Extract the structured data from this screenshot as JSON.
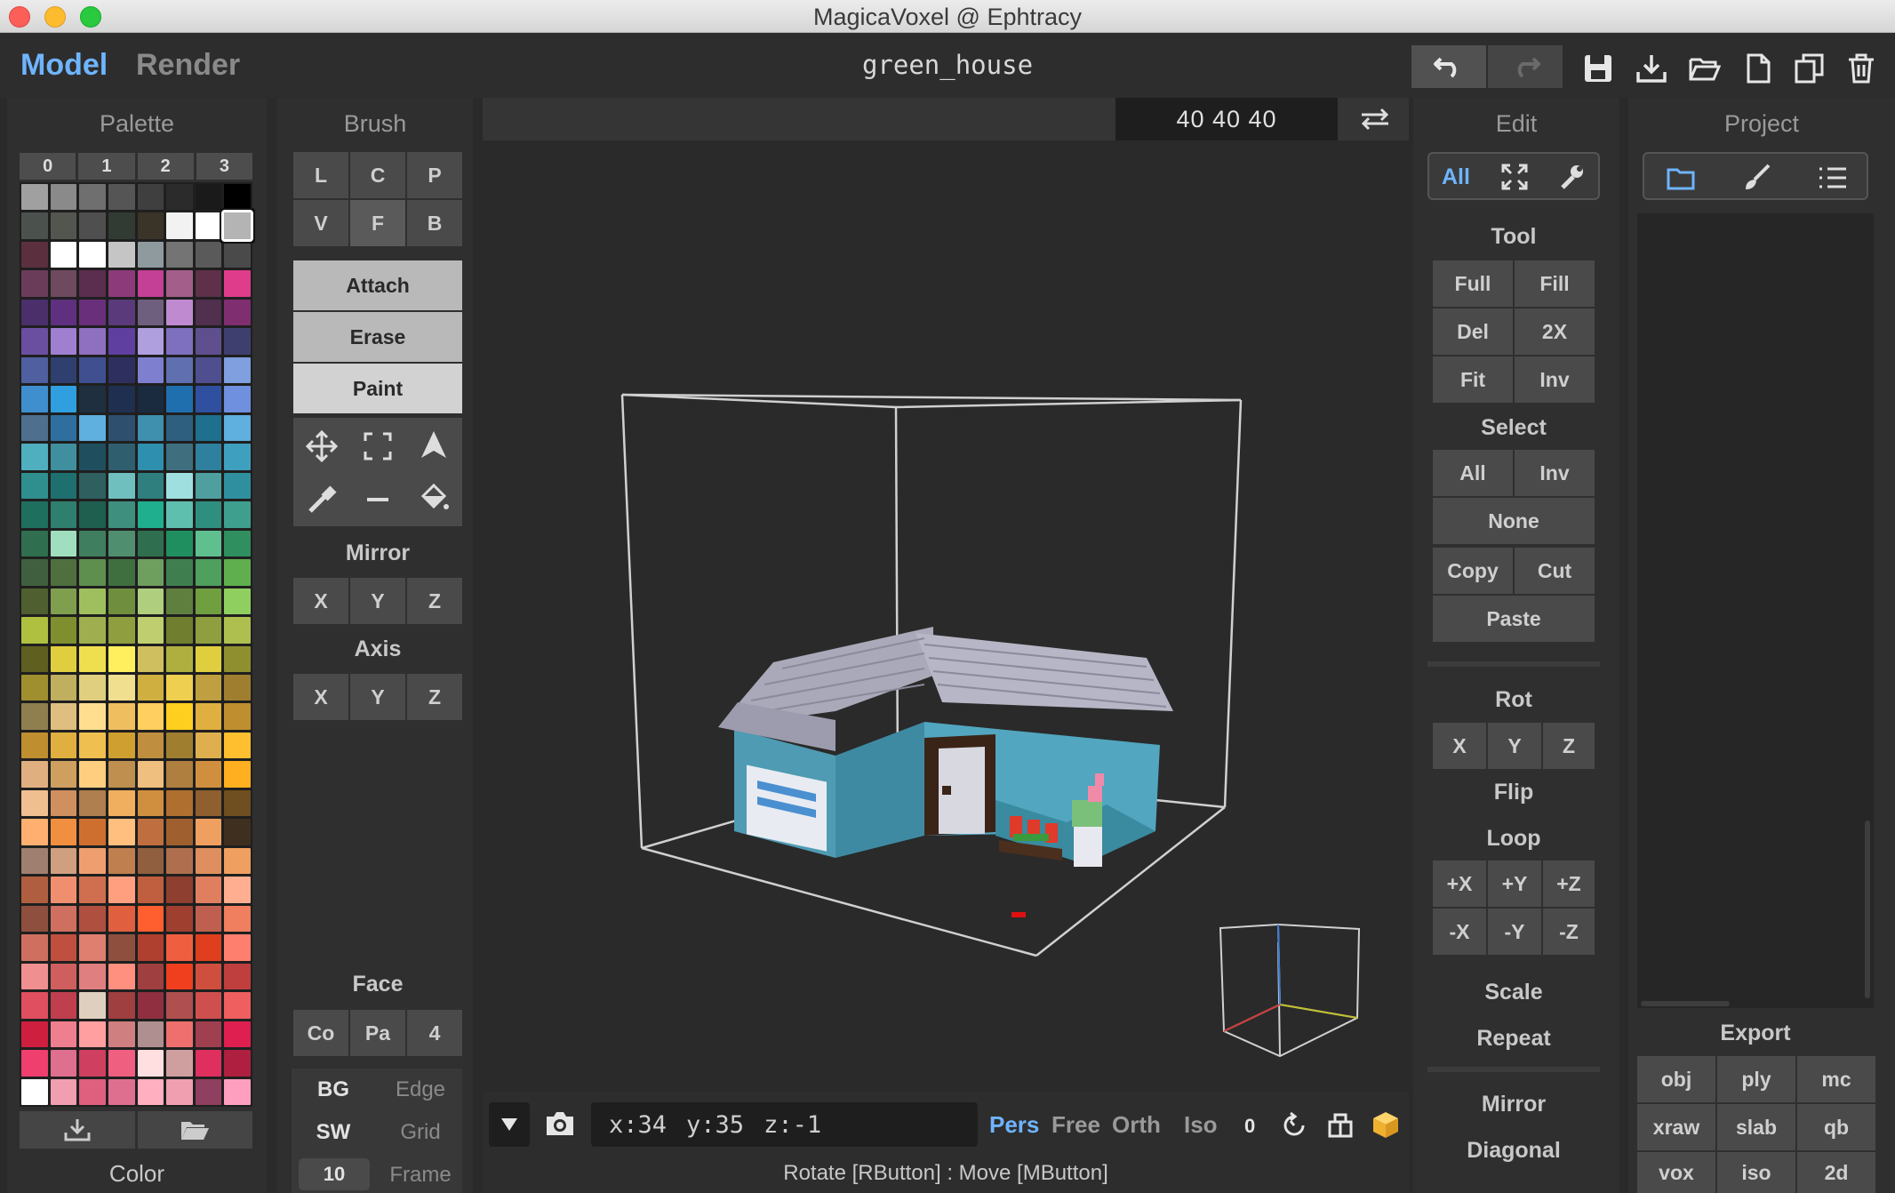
{
  "window": {
    "title": "MagicaVoxel @ Ephtracy"
  },
  "topbar": {
    "mode_model": "Model",
    "mode_render": "Render",
    "filename": "green_house"
  },
  "palette": {
    "title": "Palette",
    "tabs": [
      "0",
      "1",
      "2",
      "3"
    ],
    "footer": "Color",
    "colors": [
      "#a0a0a0",
      "#8a8a8a",
      "#6f6f6f",
      "#555555",
      "#3f3f3f",
      "#2b2b2b",
      "#1a1a1a",
      "#000000",
      "#4b524d",
      "#52564f",
      "#4f4f4f",
      "#313a33",
      "#3a3328",
      "#f2f2f2",
      "#ffffff",
      "#b4b4b4",
      "#5c2f3f",
      "#ffffff",
      "#ffffff",
      "#c5c5c5",
      "#8f9a9f",
      "#747474",
      "#5a5a5a",
      "#4a4a4a",
      "#6a3c5a",
      "#6f4a5f",
      "#5b2d4f",
      "#8d3a7a",
      "#c43f96",
      "#a35f89",
      "#5e304a",
      "#e03c8c",
      "#4a2f6a",
      "#5f3080",
      "#6a2f7a",
      "#5a3a7a",
      "#6f5f7f",
      "#bf8ad0",
      "#502f4f",
      "#7f2f6f",
      "#6a4fa0",
      "#9f7fd0",
      "#8f6fbf",
      "#5f3fa0",
      "#b09fdf",
      "#7f6fbf",
      "#5f4f8f",
      "#3f3f6f",
      "#4f5f9f",
      "#2f3f6f",
      "#3f4f8f",
      "#2f2f5f",
      "#7f7fcf",
      "#5f6faf",
      "#4f4f8f",
      "#7f9fdf",
      "#3f8fcf",
      "#2f9fdf",
      "#1f2f3f",
      "#1f2f4f",
      "#1a2a3f",
      "#1f6faf",
      "#2f4f9f",
      "#6f8fdf",
      "#4f6f8f",
      "#2f6f9f",
      "#5fafdf",
      "#2f4f6f",
      "#3f8faf",
      "#2f5f7f",
      "#1f6f8f",
      "#5fafdf",
      "#4fafbf",
      "#3f8f9f",
      "#1f4f5f",
      "#2f5f6f",
      "#2f8faf",
      "#3f6f7f",
      "#2f7f9f",
      "#3f9fbf",
      "#2f8f8f",
      "#1f6f6f",
      "#2f5f5f",
      "#6fbfbf",
      "#2f7f7f",
      "#9fdfdf",
      "#4f9f9f",
      "#2f8f9f",
      "#1f6f5f",
      "#2f7f6f",
      "#1f5f4f",
      "#3f8f7f",
      "#1faf8f",
      "#5fbfaf",
      "#2f8f7f",
      "#3f9f8f",
      "#2f6f4f",
      "#9fdfbf",
      "#3f7f5f",
      "#4f8f6f",
      "#2f6f4f",
      "#1f8f5f",
      "#5fbf8f",
      "#2f8f5f",
      "#3f5f3f",
      "#4f6f3f",
      "#5f8f4f",
      "#3f6f3f",
      "#6f9f5f",
      "#3f7f4f",
      "#4f9f5f",
      "#5faf4f",
      "#4f5f2f",
      "#7f9f4f",
      "#9fbf5f",
      "#6f8f3f",
      "#afcf7f",
      "#5f7f3f",
      "#6f9f3f",
      "#8fcf5f",
      "#afbf3f",
      "#7f8f2f",
      "#9faf4f",
      "#8f9f3f",
      "#bfcf6f",
      "#6f7f2f",
      "#8f9f3f",
      "#afbf4f",
      "#5f5f1f",
      "#dfcf3f",
      "#efdf4f",
      "#ffef5f",
      "#cfbf5f",
      "#afaf3f",
      "#dfcf3f",
      "#8f8f2f",
      "#9f8f2f",
      "#bfaf5f",
      "#dfcf7f",
      "#efdf8f",
      "#cfaf3f",
      "#efcf4f",
      "#bf9f3f",
      "#9f7f2f",
      "#8f7f4f",
      "#dfbf7f",
      "#ffdf8f",
      "#efbf5f",
      "#ffcf5f",
      "#ffcf1f",
      "#dfaf3f",
      "#bf8f2f",
      "#bf8f2f",
      "#dfaf3f",
      "#efbf4f",
      "#cf9f2f",
      "#bf8f3f",
      "#9f7f2f",
      "#dfaf4f",
      "#ffbf2f",
      "#dfaf7f",
      "#cf9f5f",
      "#ffcf7f",
      "#bf8f4f",
      "#efbf7f",
      "#af7f3f",
      "#cf8f3f",
      "#ffaf1f",
      "#efbf8f",
      "#cf8f5f",
      "#af7f4f",
      "#efaf5f",
      "#cf8f3f",
      "#af6f2f",
      "#8f5f2f",
      "#6f4f1f",
      "#ffaf6f",
      "#ef8f3f",
      "#cf6f2f",
      "#ffbf7f",
      "#bf6f3f",
      "#9f5f2f",
      "#ef9f5f",
      "#3f2f1f",
      "#9f7f6f",
      "#cf9f7f",
      "#ef9f6f",
      "#bf7f4f",
      "#8f5f3f",
      "#af6f4f",
      "#df8f5f",
      "#ef9f5f",
      "#af5f3f",
      "#ef8f6f",
      "#cf6f4f",
      "#ff9f7f",
      "#bf5f3f",
      "#8f3f2f",
      "#df7f5f",
      "#ffaf8f",
      "#8f4f3f",
      "#cf6f5f",
      "#af4f3f",
      "#df5f3f",
      "#ff5f2f",
      "#9f3f2f",
      "#bf5f4f",
      "#ef7f5f",
      "#cf6f5f",
      "#bf4f3f",
      "#df7f6f",
      "#8f4f3f",
      "#af3f2f",
      "#ef5f3f",
      "#df3f1f",
      "#ff7f6f",
      "#ef8f8f",
      "#cf5f5f",
      "#df7f7f",
      "#ff8f7f",
      "#9f3f3f",
      "#ef3f1f",
      "#cf4f3f",
      "#bf3f3f",
      "#df4f5f",
      "#bf3f4f",
      "#dfcfbf",
      "#9f3f3f",
      "#8f2f3f",
      "#af4f4f",
      "#cf4f4f",
      "#ef5f5f",
      "#cf1f3f",
      "#ef7f8f",
      "#ff9fa0",
      "#cf7f7f",
      "#af8f8f",
      "#ef6f6f",
      "#9f3f4f",
      "#df1f4f",
      "#ef3f6f",
      "#df6f8f",
      "#cf3f5f",
      "#ef5f7f",
      "#ffdfdf",
      "#cf9f9f",
      "#df2f5f",
      "#af1f3f",
      "#ffffff",
      "#ef9faf",
      "#df5f7f",
      "#df6f8f",
      "#ffafbf",
      "#ef9faf",
      "#8f3f5f",
      "#ff9fbf"
    ]
  },
  "brush": {
    "title": "Brush",
    "row1": [
      "L",
      "C",
      "P"
    ],
    "row2": [
      "V",
      "F",
      "B"
    ],
    "modes": [
      "Attach",
      "Erase",
      "Paint"
    ],
    "mirror_label": "Mirror",
    "axis_label": "Axis",
    "xyz": [
      "X",
      "Y",
      "Z"
    ],
    "face_label": "Face",
    "face_buttons": [
      "Co",
      "Pa",
      "4"
    ],
    "bg": "BG",
    "edge": "Edge",
    "sw": "SW",
    "grid": "Grid",
    "frame_value": "10",
    "frame": "Frame"
  },
  "viewport": {
    "dims": "40  40  40",
    "coords": {
      "x": "x:34",
      "y": "y:35",
      "z": "z:-1"
    },
    "view_modes": [
      "Pers",
      "Free",
      "Orth",
      "Iso"
    ],
    "active_view": "Pers",
    "rotation_value": "0",
    "status": "Rotate [RButton] : Move [MButton]"
  },
  "edit": {
    "title": "Edit",
    "tab_all": "All",
    "tool_label": "Tool",
    "tool_buttons": [
      "Full",
      "Fill",
      "Del",
      "2X",
      "Fit",
      "Inv"
    ],
    "select_label": "Select",
    "select_pairs": [
      "All",
      "Inv"
    ],
    "none": "None",
    "copy": "Copy",
    "cut": "Cut",
    "paste": "Paste",
    "rot_label": "Rot",
    "rot_buttons": [
      "X",
      "Y",
      "Z"
    ],
    "flip_label": "Flip",
    "loop_label": "Loop",
    "loop_buttons": [
      "+X",
      "+Y",
      "+Z",
      "-X",
      "-Y",
      "-Z"
    ],
    "scale_label": "Scale",
    "repeat_label": "Repeat",
    "mirror_label": "Mirror",
    "diagonal_label": "Diagonal"
  },
  "project": {
    "title": "Project",
    "export_label": "Export",
    "export_buttons": [
      "obj",
      "ply",
      "mc",
      "xraw",
      "slab",
      "qb",
      "vox",
      "iso",
      "2d"
    ]
  },
  "colors": {
    "accent": "#6fb4ff",
    "panel": "#333333",
    "button": "#4a4a4a"
  }
}
